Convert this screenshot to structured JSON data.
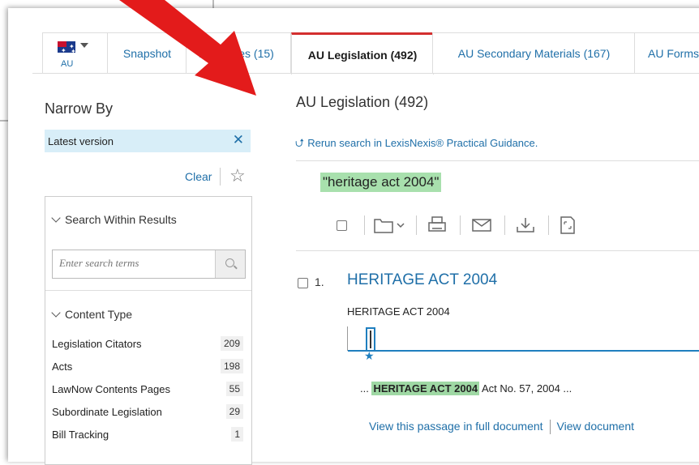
{
  "jurisdiction": {
    "code": "AU"
  },
  "tabs": [
    {
      "label": "Snapshot"
    },
    {
      "label": "AU Cases (15)"
    },
    {
      "label": "AU Legislation (492)"
    },
    {
      "label": "AU Secondary Materials (167)"
    },
    {
      "label": "AU Forms"
    }
  ],
  "sidebar": {
    "heading": "Narrow By",
    "active_filter": "Latest version",
    "clear_label": "Clear",
    "search_within": {
      "heading": "Search Within Results",
      "placeholder": "Enter search terms"
    },
    "content_type": {
      "heading": "Content Type",
      "items": [
        {
          "label": "Legislation Citators",
          "count": "209"
        },
        {
          "label": "Acts",
          "count": "198"
        },
        {
          "label": "LawNow Contents Pages",
          "count": "55"
        },
        {
          "label": "Subordinate Legislation",
          "count": "29"
        },
        {
          "label": "Bill Tracking",
          "count": "1"
        }
      ]
    }
  },
  "results": {
    "title": "AU Legislation (492)",
    "rerun_label": "Rerun search in LexisNexis® Practical Guidance.",
    "query": "\"heritage act 2004\"",
    "documents": [
      {
        "number": "1.",
        "title": "HERITAGE ACT 2004",
        "subtitle": "HERITAGE ACT 2004",
        "snippet_prefix": "...",
        "snippet_highlight": "HERITAGE ACT 2004",
        "snippet_suffix": "Act No. 57, 2004 ...",
        "link_passage": "View this passage in full document",
        "link_document": "View document"
      }
    ]
  },
  "colors": {
    "accent": "#1f6fa8",
    "active_tab": "#d32f2f",
    "highlight": "#a8e0ad",
    "annotation_arrow": "#e31b1b",
    "filter_bg": "#d8eef8"
  }
}
